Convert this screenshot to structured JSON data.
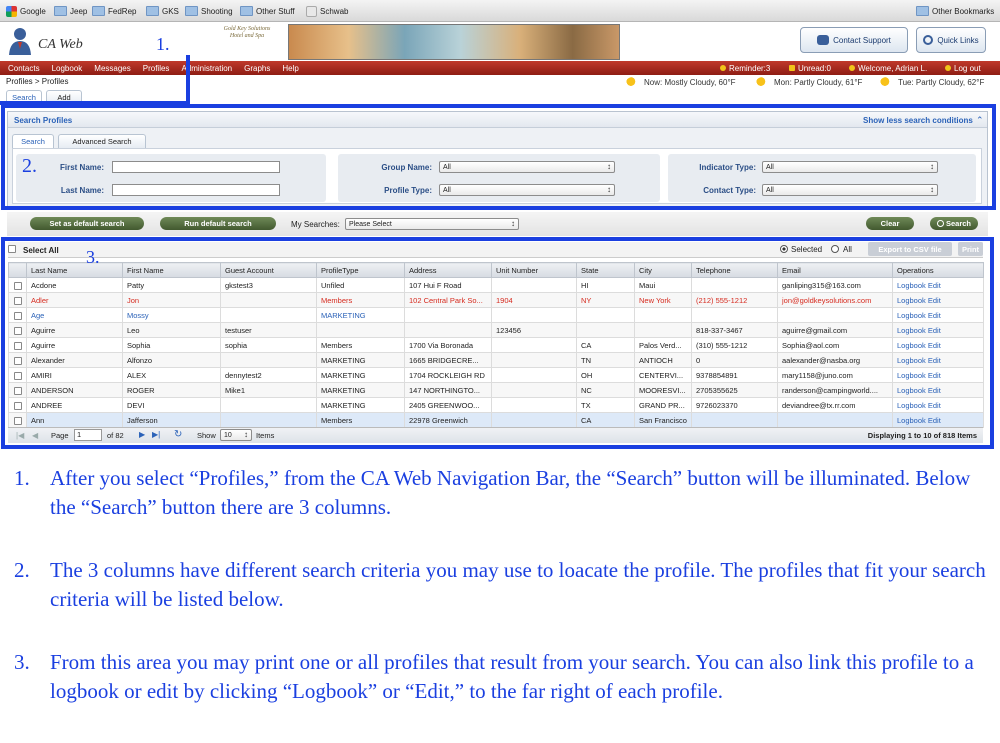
{
  "bookmarks": {
    "items": [
      {
        "label": "Google",
        "icon": "google-icon"
      },
      {
        "label": "Jeep",
        "icon": "folder-icon"
      },
      {
        "label": "FedRep",
        "icon": "folder-icon"
      },
      {
        "label": "GKS",
        "icon": "folder-icon"
      },
      {
        "label": "Shooting",
        "icon": "folder-icon"
      },
      {
        "label": "Other Stuff",
        "icon": "folder-icon"
      },
      {
        "label": "Schwab",
        "icon": "schwab-icon"
      }
    ],
    "other_label": "Other Bookmarks"
  },
  "header": {
    "app_title": "CA Web",
    "hotel_logo_text": "Gold Key Solutions Hotel and Spa",
    "contact_support": "Contact Support",
    "quick_links": "Quick Links"
  },
  "nav": {
    "items": [
      "Contacts",
      "Logbook",
      "Messages",
      "Profiles",
      "Administration",
      "Graphs",
      "Help"
    ],
    "reminder": "Reminder:3",
    "unread": "Unread:0",
    "welcome": "Welcome, Adrian L.",
    "logout": "Log out"
  },
  "breadcrumb": "Profiles > Profiles",
  "subtabs": {
    "search": "Search",
    "add": "Add"
  },
  "weather": [
    "Now: Mostly Cloudy, 60°F",
    "Mon: Partly Cloudy, 61°F",
    "Tue: Partly Cloudy, 62°F"
  ],
  "search_panel": {
    "title": "Search Profiles",
    "toggle": "Show less search conditions",
    "tab_search": "Search",
    "tab_advanced": "Advanced Search",
    "first_name_label": "First Name:",
    "last_name_label": "Last Name:",
    "first_name_value": "",
    "last_name_value": "",
    "group_name_label": "Group Name:",
    "group_name_value": "All",
    "profile_type_label": "Profile Type:",
    "profile_type_value": "All",
    "indicator_type_label": "Indicator Type:",
    "indicator_type_value": "All",
    "contact_type_label": "Contact Type:",
    "contact_type_value": "All"
  },
  "toolbar": {
    "set_default": "Set as default search",
    "run_default": "Run default search",
    "my_searches_label": "My Searches:",
    "my_searches_value": "Please Select",
    "clear": "Clear",
    "search": "Search"
  },
  "grid": {
    "select_all": "Select All",
    "selected": "Selected",
    "all": "All",
    "export": "Export to CSV file",
    "print": "Print",
    "columns": [
      "Last Name",
      "First Name",
      "Guest Account",
      "ProfileType",
      "Address",
      "Unit Number",
      "State",
      "City",
      "Telephone",
      "Email",
      "Operations"
    ],
    "rows": [
      {
        "c": [
          "Acdone",
          "Patty",
          "gkstest3",
          "Unfiled",
          "107 Hui F Road",
          "",
          "HI",
          "Maui",
          "",
          "ganliping315@163.com"
        ],
        "style": "normal"
      },
      {
        "c": [
          "Adler",
          "Jon",
          "",
          "Members",
          "102 Central Park So...",
          "1904",
          "NY",
          "New York",
          "(212) 555-1212",
          "jon@goldkeysolutions.com"
        ],
        "style": "red"
      },
      {
        "c": [
          "Age",
          "Mossy",
          "",
          "MARKETING",
          "",
          "",
          "",
          "",
          "",
          ""
        ],
        "style": "blue"
      },
      {
        "c": [
          "Aguirre",
          "Leo",
          "testuser",
          "",
          "",
          "123456",
          "",
          "",
          "818-337-3467",
          "aguirre@gmail.com"
        ],
        "style": "normal"
      },
      {
        "c": [
          "Aguirre",
          "Sophia",
          "sophia",
          "Members",
          "1700 Via Boronada",
          "",
          "CA",
          "Palos Verd...",
          "(310) 555-1212",
          "Sophia@aol.com"
        ],
        "style": "normal"
      },
      {
        "c": [
          "Alexander",
          "Alfonzo",
          "",
          "MARKETING",
          "1665 BRIDGECRE...",
          "",
          "TN",
          "ANTIOCH",
          "0",
          "aalexander@nasba.org"
        ],
        "style": "normal"
      },
      {
        "c": [
          "AMIRI",
          "ALEX",
          "dennytest2",
          "MARKETING",
          "1704 ROCKLEIGH RD",
          "",
          "OH",
          "CENTERVI...",
          "9378854891",
          "mary1158@juno.com"
        ],
        "style": "normal"
      },
      {
        "c": [
          "ANDERSON",
          "ROGER",
          "Mike1",
          "MARKETING",
          "147 NORTHINGTO...",
          "",
          "NC",
          "MOORESVI...",
          "2705355625",
          "randerson@campingworld...."
        ],
        "style": "normal"
      },
      {
        "c": [
          "ANDREE",
          "DEVI",
          "",
          "MARKETING",
          "2405 GREENWOO...",
          "",
          "TX",
          "GRAND PR...",
          "9726023370",
          "deviandree@tx.rr.com"
        ],
        "style": "normal"
      },
      {
        "c": [
          "Ann",
          "Jafferson",
          "",
          "Members",
          "22978 Greenwich",
          "",
          "CA",
          "San Francisco",
          "",
          ""
        ],
        "style": "highlight"
      }
    ],
    "op_logbook": "Logbook",
    "op_edit": "Edit"
  },
  "pager": {
    "page_label": "Page",
    "page_value": "1",
    "of_label": "of 82",
    "show_label": "Show",
    "show_value": "10",
    "items_label": "Items",
    "displaying": "Displaying 1 to 10 of 818 Items"
  },
  "annotations": {
    "n1": "1.",
    "n2": "2.",
    "n3": "3.",
    "instructions": [
      {
        "n": "1.",
        "text": "After you select “Profiles,” from the CA Web Navigation Bar, the “Search” button will be illuminated.  Below the “Search” button there are 3 columns."
      },
      {
        "n": "2.",
        "text": "The 3 columns have different search criteria you may use to loacate the profile.  The profiles that fit your search criteria will be listed below."
      },
      {
        "n": "3.",
        "text": "From this area you may print one or all profiles that result from your search.  You can also link this profile to a logbook or  edit     by clicking “Logbook” or “Edit,” to the far right of each profile."
      }
    ],
    "frame_color": "#1a3fe0"
  }
}
